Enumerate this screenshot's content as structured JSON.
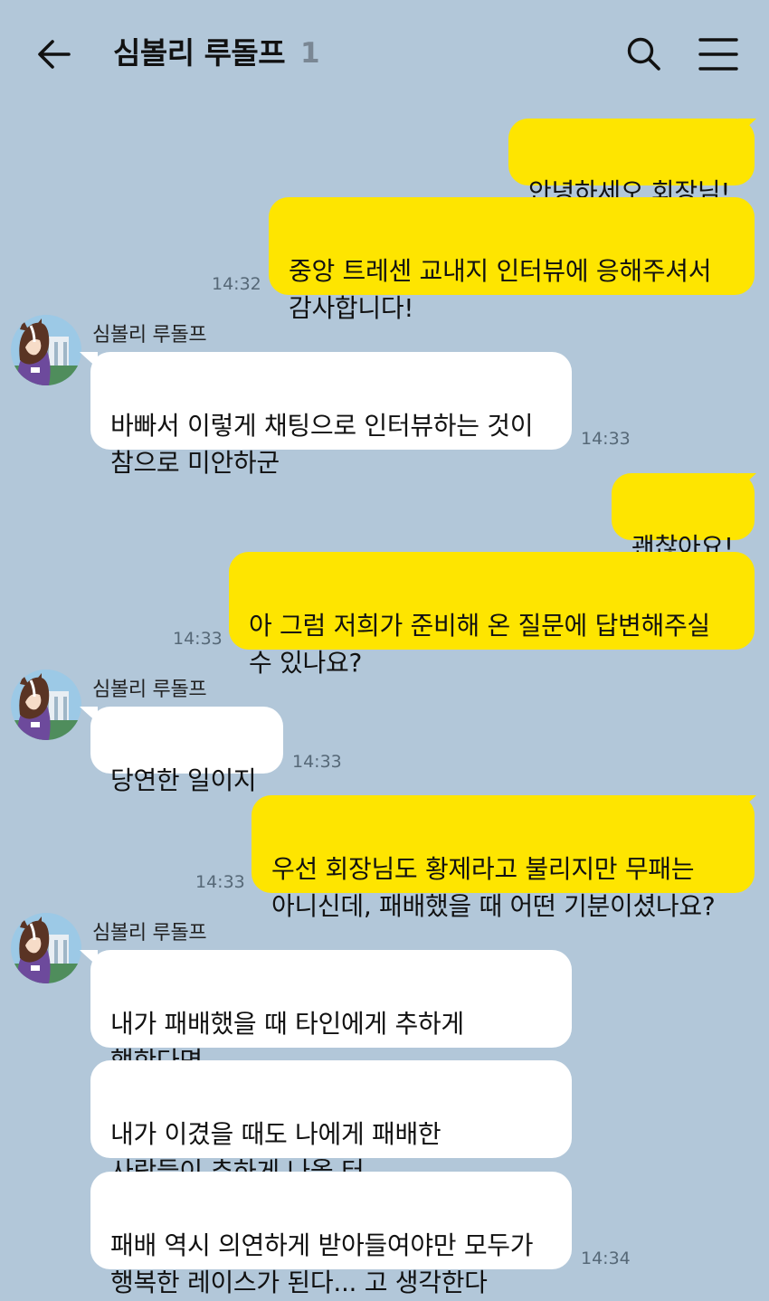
{
  "header": {
    "title": "심볼리 루돌프",
    "member_count": "1"
  },
  "messages": {
    "m1": {
      "text": "안녕하세오 회장님!"
    },
    "m2": {
      "text": "중앙 트레센 교내지 인터뷰에 응해주셔서\n감사합니다!",
      "time": "14:32"
    },
    "m3": {
      "sender": "심볼리 루돌프",
      "text": "바빠서 이렇게 채팅으로 인터뷰하는 것이\n참으로 미안하군",
      "time": "14:33"
    },
    "m4": {
      "text": "괜찮아요!"
    },
    "m5": {
      "text": "아 그럼 저희가 준비해 온 질문에 답변해주실\n수 있나요?",
      "time": "14:33"
    },
    "m6": {
      "sender": "심볼리 루돌프",
      "text": "당연한 일이지",
      "time": "14:33"
    },
    "m7": {
      "text": "우선 회장님도 황제라고 불리지만 무패는\n아니신데, 패배했을 때 어떤 기분이셨나요?",
      "time": "14:33"
    },
    "m8": {
      "sender": "심볼리 루돌프",
      "text": "내가 패배했을 때 타인에게 추하게\n행한다면"
    },
    "m9": {
      "text": "내가 이겼을 때도 나에게 패배한\n사람들이 추하게 나올 터"
    },
    "m10": {
      "text": "패배 역시 의연하게 받아들여야만 모두가\n행복한 레이스가 된다... 고 생각한다",
      "time": "14:34"
    }
  },
  "icons": {
    "back": "arrow-left-icon",
    "search": "search-icon",
    "menu": "hamburger-menu-icon"
  },
  "colors": {
    "background": "#b2c7d9",
    "my_bubble": "#fee500",
    "their_bubble": "#ffffff",
    "timestamp": "#566877"
  }
}
